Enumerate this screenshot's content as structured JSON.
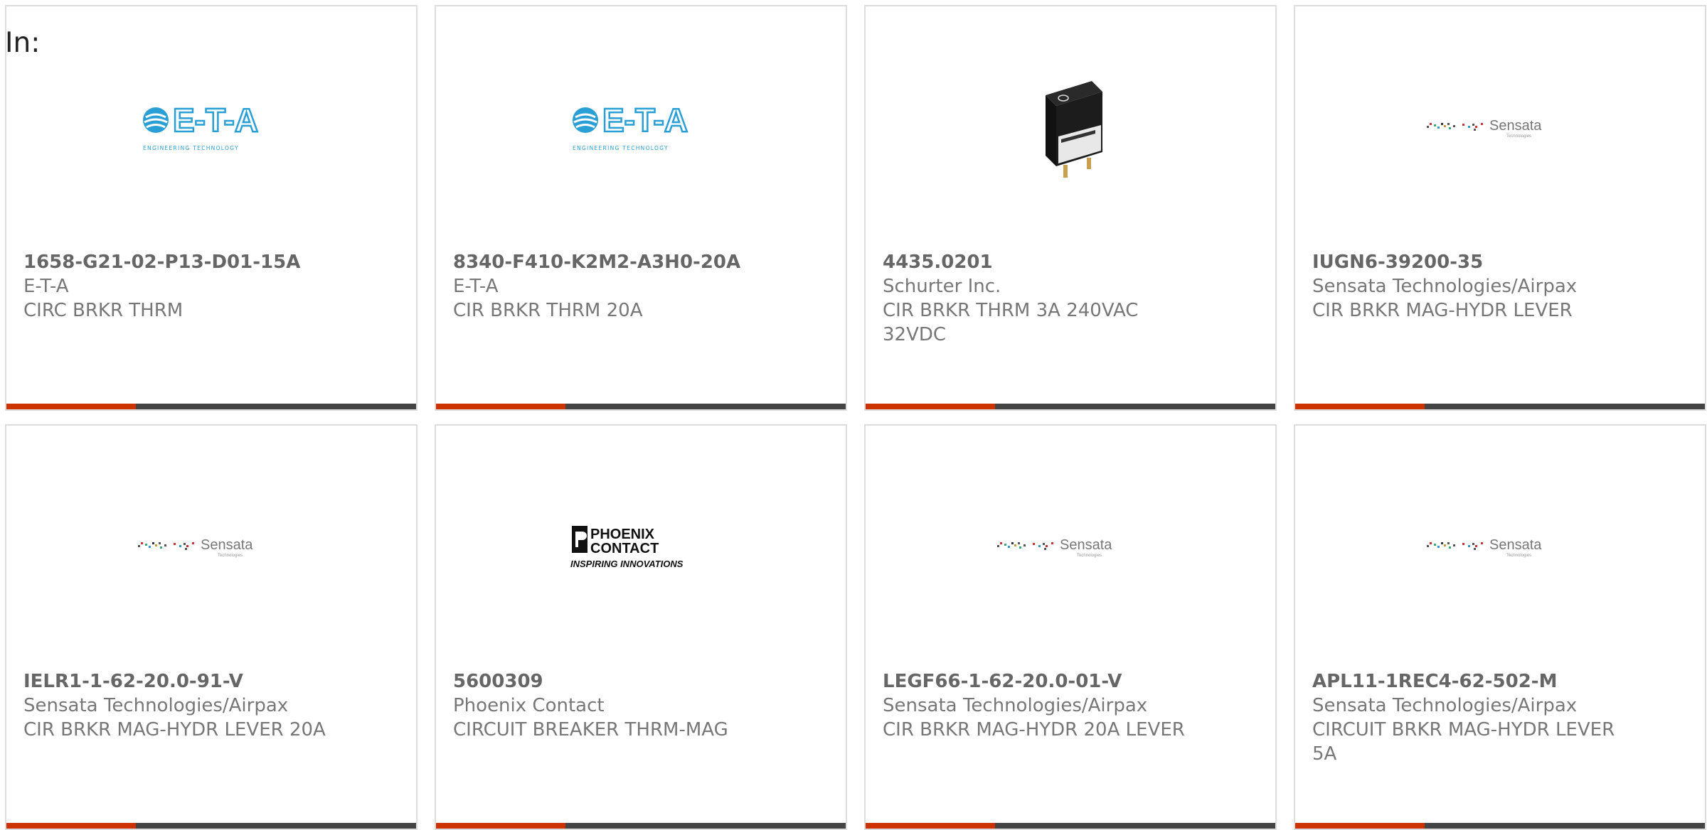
{
  "heading": "In:",
  "colors": {
    "accent_bar": "#cc3300",
    "dark_bar": "#444444",
    "eta_blue": "#2a9fd6"
  },
  "products": [
    {
      "part_number": "1658-G21-02-P13-D01-15A",
      "manufacturer": "E-T-A",
      "description": "CIRC BRKR THRM",
      "image": "eta-logo"
    },
    {
      "part_number": "8340-F410-K2M2-A3H0-20A",
      "manufacturer": "E-T-A",
      "description": "CIR BRKR THRM 20A",
      "image": "eta-logo"
    },
    {
      "part_number": "4435.0201",
      "manufacturer": "Schurter Inc.",
      "description": "CIR BRKR THRM 3A 240VAC 32VDC",
      "image": "breaker-photo"
    },
    {
      "part_number": "IUGN6-39200-35",
      "manufacturer": "Sensata Technologies/Airpax",
      "description": "CIR BRKR MAG-HYDR LEVER",
      "image": "sensata-logo"
    },
    {
      "part_number": "IELR1-1-62-20.0-91-V",
      "manufacturer": "Sensata Technologies/Airpax",
      "description": "CIR BRKR MAG-HYDR LEVER 20A",
      "image": "sensata-logo"
    },
    {
      "part_number": "5600309",
      "manufacturer": "Phoenix Contact",
      "description": "CIRCUIT BREAKER THRM-MAG",
      "image": "phoenix-logo"
    },
    {
      "part_number": "LEGF66-1-62-20.0-01-V",
      "manufacturer": "Sensata Technologies/Airpax",
      "description": "CIR BRKR MAG-HYDR 20A LEVER",
      "image": "sensata-logo"
    },
    {
      "part_number": "APL11-1REC4-62-502-M",
      "manufacturer": "Sensata Technologies/Airpax",
      "description": "CIRCUIT BRKR MAG-HYDR LEVER 5A",
      "image": "sensata-logo"
    }
  ],
  "logos": {
    "eta": {
      "text": "E-T-A",
      "tagline": "ENGINEERING TECHNOLOGY"
    },
    "sensata": {
      "text": "Sensata",
      "tagline": "Technologies"
    },
    "phoenix": {
      "line1": "PHOENIX",
      "line2": "CONTACT",
      "tagline": "INSPIRING INNOVATIONS"
    }
  }
}
